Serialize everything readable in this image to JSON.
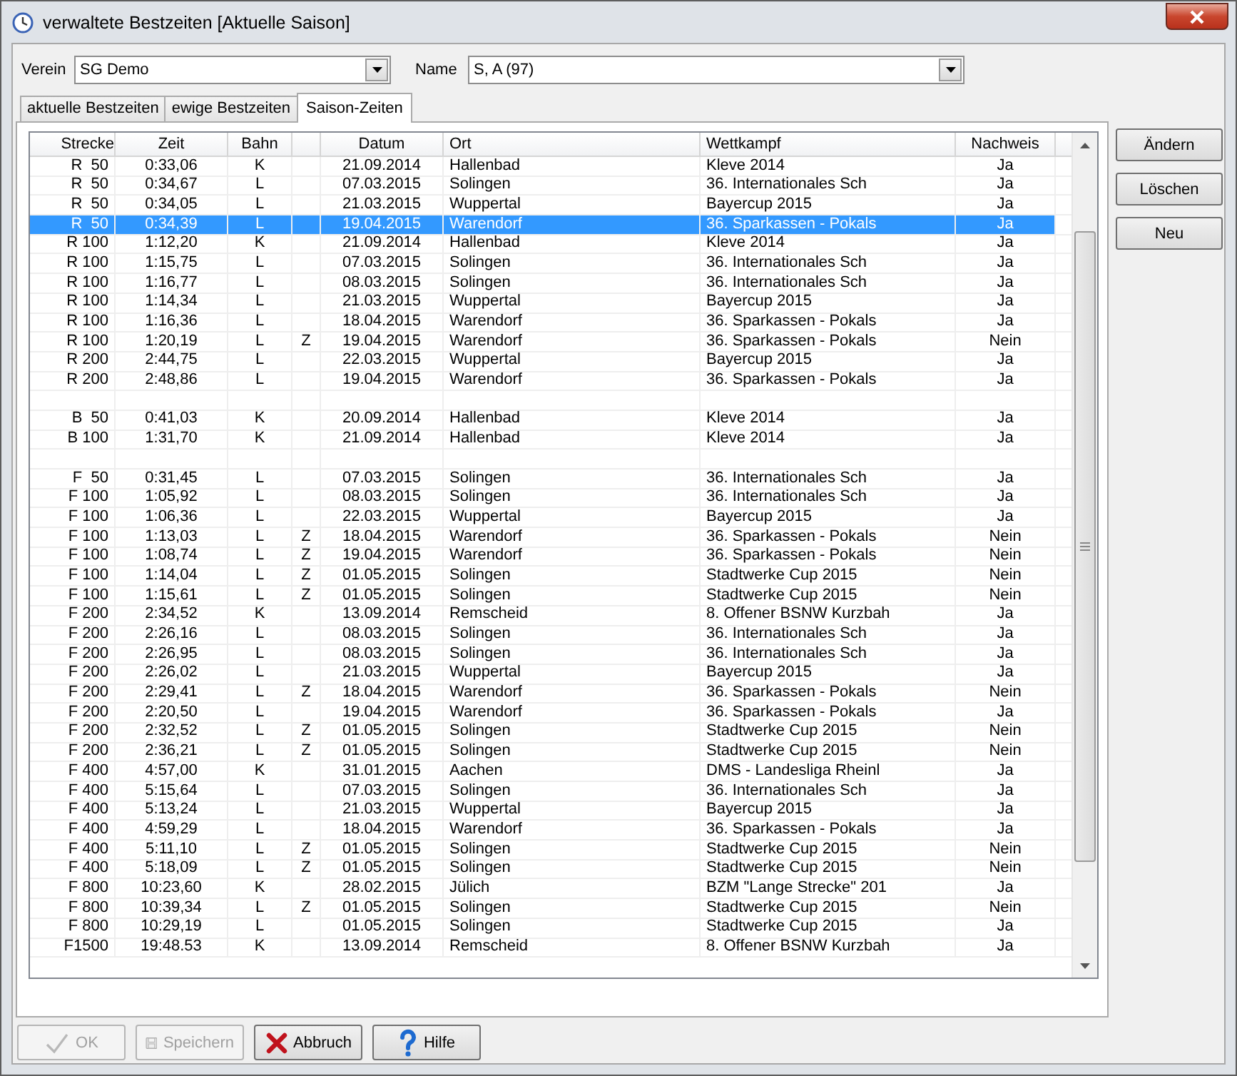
{
  "window": {
    "title": "verwaltete Bestzeiten [Aktuelle Saison]"
  },
  "filters": [
    {
      "label": "Verein",
      "value": "SG Demo"
    },
    {
      "label": "Name",
      "value": "S, A (97)"
    }
  ],
  "tabs": [
    {
      "label": "aktuelle Bestzeiten",
      "selected": false
    },
    {
      "label": "ewige Bestzeiten",
      "selected": false
    },
    {
      "label": "Saison-Zeiten",
      "selected": true
    }
  ],
  "table": {
    "columns": [
      "Strecke",
      "Zeit",
      "Bahn",
      "Datum",
      "Ort",
      "Wettkampf",
      "Nachweis"
    ],
    "rows": [
      {
        "kind": "entry",
        "selected": false,
        "strecke": "R  50",
        "zeit": "0:33,06",
        "bahn": "K",
        "datum": "21.09.2014",
        "ort": "Hallenbad",
        "wettkampf": "Kleve 2014",
        "nachweis": "Ja"
      },
      {
        "kind": "entry",
        "selected": false,
        "strecke": "R  50",
        "zeit": "0:34,67",
        "bahn": "L",
        "datum": "07.03.2015",
        "ort": "Solingen",
        "wettkampf": "36. Internationales Sch",
        "nachweis": "Ja"
      },
      {
        "kind": "entry",
        "selected": false,
        "strecke": "R  50",
        "zeit": "0:34,05",
        "bahn": "L",
        "datum": "21.03.2015",
        "ort": "Wuppertal",
        "wettkampf": "Bayercup 2015",
        "nachweis": "Ja"
      },
      {
        "kind": "entry",
        "selected": true,
        "strecke": "R  50",
        "zeit": "0:34,39",
        "bahn": "L",
        "datum": "19.04.2015",
        "ort": "Warendorf",
        "wettkampf": "36. Sparkassen - Pokals",
        "nachweis": "Ja"
      },
      {
        "kind": "entry",
        "selected": false,
        "strecke": "R 100",
        "zeit": "1:12,20",
        "bahn": "K",
        "datum": "21.09.2014",
        "ort": "Hallenbad",
        "wettkampf": "Kleve 2014",
        "nachweis": "Ja"
      },
      {
        "kind": "entry",
        "selected": false,
        "strecke": "R 100",
        "zeit": "1:15,75",
        "bahn": "L",
        "datum": "07.03.2015",
        "ort": "Solingen",
        "wettkampf": "36. Internationales Sch",
        "nachweis": "Ja"
      },
      {
        "kind": "entry",
        "selected": false,
        "strecke": "R 100",
        "zeit": "1:16,77",
        "bahn": "L",
        "datum": "08.03.2015",
        "ort": "Solingen",
        "wettkampf": "36. Internationales Sch",
        "nachweis": "Ja"
      },
      {
        "kind": "entry",
        "selected": false,
        "strecke": "R 100",
        "zeit": "1:14,34",
        "bahn": "L",
        "datum": "21.03.2015",
        "ort": "Wuppertal",
        "wettkampf": "Bayercup 2015",
        "nachweis": "Ja"
      },
      {
        "kind": "entry",
        "selected": false,
        "strecke": "R 100",
        "zeit": "1:16,36",
        "bahn": "L",
        "datum": "18.04.2015",
        "ort": "Warendorf",
        "wettkampf": "36. Sparkassen - Pokals",
        "nachweis": "Ja"
      },
      {
        "kind": "entry",
        "selected": false,
        "strecke": "R 100",
        "zeit": "1:20,19",
        "bahn": "L",
        "column_4": "Z",
        "datum": "19.04.2015",
        "ort": "Warendorf",
        "wettkampf": "36. Sparkassen - Pokals",
        "nachweis": "Nein"
      },
      {
        "kind": "entry",
        "selected": false,
        "strecke": "R 200",
        "zeit": "2:44,75",
        "bahn": "L",
        "datum": "22.03.2015",
        "ort": "Wuppertal",
        "wettkampf": "Bayercup 2015",
        "nachweis": "Ja"
      },
      {
        "kind": "entry",
        "selected": false,
        "strecke": "R 200",
        "zeit": "2:48,86",
        "bahn": "L",
        "datum": "19.04.2015",
        "ort": "Warendorf",
        "wettkampf": "36. Sparkassen - Pokals",
        "nachweis": "Ja"
      },
      {
        "kind": "blank",
        "selected": false
      },
      {
        "kind": "entry",
        "selected": false,
        "strecke": "B  50",
        "zeit": "0:41,03",
        "bahn": "K",
        "datum": "20.09.2014",
        "ort": "Hallenbad",
        "wettkampf": "Kleve 2014",
        "nachweis": "Ja"
      },
      {
        "kind": "entry",
        "selected": false,
        "strecke": "B 100",
        "zeit": "1:31,70",
        "bahn": "K",
        "datum": "21.09.2014",
        "ort": "Hallenbad",
        "wettkampf": "Kleve 2014",
        "nachweis": "Ja"
      },
      {
        "kind": "blank",
        "selected": false
      },
      {
        "kind": "entry",
        "selected": false,
        "strecke": "F  50",
        "zeit": "0:31,45",
        "bahn": "L",
        "datum": "07.03.2015",
        "ort": "Solingen",
        "wettkampf": "36. Internationales Sch",
        "nachweis": "Ja"
      },
      {
        "kind": "entry",
        "selected": false,
        "strecke": "F 100",
        "zeit": "1:05,92",
        "bahn": "L",
        "datum": "08.03.2015",
        "ort": "Solingen",
        "wettkampf": "36. Internationales Sch",
        "nachweis": "Ja"
      },
      {
        "kind": "entry",
        "selected": false,
        "strecke": "F 100",
        "zeit": "1:06,36",
        "bahn": "L",
        "datum": "22.03.2015",
        "ort": "Wuppertal",
        "wettkampf": "Bayercup 2015",
        "nachweis": "Ja"
      },
      {
        "kind": "entry",
        "selected": false,
        "strecke": "F 100",
        "zeit": "1:13,03",
        "bahn": "L",
        "column_4": "Z",
        "datum": "18.04.2015",
        "ort": "Warendorf",
        "wettkampf": "36. Sparkassen - Pokals",
        "nachweis": "Nein"
      },
      {
        "kind": "entry",
        "selected": false,
        "strecke": "F 100",
        "zeit": "1:08,74",
        "bahn": "L",
        "column_4": "Z",
        "datum": "19.04.2015",
        "ort": "Warendorf",
        "wettkampf": "36. Sparkassen - Pokals",
        "nachweis": "Nein"
      },
      {
        "kind": "entry",
        "selected": false,
        "strecke": "F 100",
        "zeit": "1:14,04",
        "bahn": "L",
        "column_4": "Z",
        "datum": "01.05.2015",
        "ort": "Solingen",
        "wettkampf": "Stadtwerke Cup 2015",
        "nachweis": "Nein"
      },
      {
        "kind": "entry",
        "selected": false,
        "strecke": "F 100",
        "zeit": "1:15,61",
        "bahn": "L",
        "column_4": "Z",
        "datum": "01.05.2015",
        "ort": "Solingen",
        "wettkampf": "Stadtwerke Cup 2015",
        "nachweis": "Nein"
      },
      {
        "kind": "entry",
        "selected": false,
        "strecke": "F 200",
        "zeit": "2:34,52",
        "bahn": "K",
        "datum": "13.09.2014",
        "ort": "Remscheid",
        "wettkampf": "8. Offener BSNW Kurzbah",
        "nachweis": "Ja"
      },
      {
        "kind": "entry",
        "selected": false,
        "strecke": "F 200",
        "zeit": "2:26,16",
        "bahn": "L",
        "datum": "08.03.2015",
        "ort": "Solingen",
        "wettkampf": "36. Internationales Sch",
        "nachweis": "Ja"
      },
      {
        "kind": "entry",
        "selected": false,
        "strecke": "F 200",
        "zeit": "2:26,95",
        "bahn": "L",
        "datum": "08.03.2015",
        "ort": "Solingen",
        "wettkampf": "36. Internationales Sch",
        "nachweis": "Ja"
      },
      {
        "kind": "entry",
        "selected": false,
        "strecke": "F 200",
        "zeit": "2:26,02",
        "bahn": "L",
        "datum": "21.03.2015",
        "ort": "Wuppertal",
        "wettkampf": "Bayercup 2015",
        "nachweis": "Ja"
      },
      {
        "kind": "entry",
        "selected": false,
        "strecke": "F 200",
        "zeit": "2:29,41",
        "bahn": "L",
        "column_4": "Z",
        "datum": "18.04.2015",
        "ort": "Warendorf",
        "wettkampf": "36. Sparkassen - Pokals",
        "nachweis": "Nein"
      },
      {
        "kind": "entry",
        "selected": false,
        "strecke": "F 200",
        "zeit": "2:20,50",
        "bahn": "L",
        "datum": "19.04.2015",
        "ort": "Warendorf",
        "wettkampf": "36. Sparkassen - Pokals",
        "nachweis": "Ja"
      },
      {
        "kind": "entry",
        "selected": false,
        "strecke": "F 200",
        "zeit": "2:32,52",
        "bahn": "L",
        "column_4": "Z",
        "datum": "01.05.2015",
        "ort": "Solingen",
        "wettkampf": "Stadtwerke Cup 2015",
        "nachweis": "Nein"
      },
      {
        "kind": "entry",
        "selected": false,
        "strecke": "F 200",
        "zeit": "2:36,21",
        "bahn": "L",
        "column_4": "Z",
        "datum": "01.05.2015",
        "ort": "Solingen",
        "wettkampf": "Stadtwerke Cup 2015",
        "nachweis": "Nein"
      },
      {
        "kind": "entry",
        "selected": false,
        "strecke": "F 400",
        "zeit": "4:57,00",
        "bahn": "K",
        "datum": "31.01.2015",
        "ort": "Aachen",
        "wettkampf": "DMS - Landesliga Rheinl",
        "nachweis": "Ja"
      },
      {
        "kind": "entry",
        "selected": false,
        "strecke": "F 400",
        "zeit": "5:15,64",
        "bahn": "L",
        "datum": "07.03.2015",
        "ort": "Solingen",
        "wettkampf": "36. Internationales Sch",
        "nachweis": "Ja"
      },
      {
        "kind": "entry",
        "selected": false,
        "strecke": "F 400",
        "zeit": "5:13,24",
        "bahn": "L",
        "datum": "21.03.2015",
        "ort": "Wuppertal",
        "wettkampf": "Bayercup 2015",
        "nachweis": "Ja"
      },
      {
        "kind": "entry",
        "selected": false,
        "strecke": "F 400",
        "zeit": "4:59,29",
        "bahn": "L",
        "datum": "18.04.2015",
        "ort": "Warendorf",
        "wettkampf": "36. Sparkassen - Pokals",
        "nachweis": "Ja"
      },
      {
        "kind": "entry",
        "selected": false,
        "strecke": "F 400",
        "zeit": "5:11,10",
        "bahn": "L",
        "column_4": "Z",
        "datum": "01.05.2015",
        "ort": "Solingen",
        "wettkampf": "Stadtwerke Cup 2015",
        "nachweis": "Nein"
      },
      {
        "kind": "entry",
        "selected": false,
        "strecke": "F 400",
        "zeit": "5:18,09",
        "bahn": "L",
        "column_4": "Z",
        "datum": "01.05.2015",
        "ort": "Solingen",
        "wettkampf": "Stadtwerke Cup 2015",
        "nachweis": "Nein"
      },
      {
        "kind": "entry",
        "selected": false,
        "strecke": "F 800",
        "zeit": "10:23,60",
        "bahn": "K",
        "datum": "28.02.2015",
        "ort": "Jülich",
        "wettkampf": "BZM \"Lange Strecke\" 201",
        "nachweis": "Ja"
      },
      {
        "kind": "entry",
        "selected": false,
        "strecke": "F 800",
        "zeit": "10:39,34",
        "bahn": "L",
        "column_4": "Z",
        "datum": "01.05.2015",
        "ort": "Solingen",
        "wettkampf": "Stadtwerke Cup 2015",
        "nachweis": "Nein"
      },
      {
        "kind": "entry",
        "selected": false,
        "strecke": "F 800",
        "zeit": "10:29,19",
        "bahn": "L",
        "datum": "01.05.2015",
        "ort": "Solingen",
        "wettkampf": "Stadtwerke Cup 2015",
        "nachweis": "Ja"
      },
      {
        "kind": "entry",
        "selected": false,
        "strecke": "F1500",
        "zeit": "19:48.53",
        "bahn": "K",
        "datum": "13.09.2014",
        "ort": "Remscheid",
        "wettkampf": "8. Offener BSNW Kurzbah",
        "nachweis": "Ja"
      }
    ]
  },
  "side_buttons": [
    {
      "label": "Ändern",
      "disabled": false
    },
    {
      "label": "Löschen",
      "disabled": false
    },
    {
      "label": "Neu",
      "disabled": false
    }
  ],
  "bottom_buttons": [
    {
      "kind": "ok",
      "label": "OK",
      "disabled": true
    },
    {
      "kind": "save",
      "label": "Speichern",
      "disabled": true
    },
    {
      "kind": "cancel",
      "label": "Abbruch",
      "disabled": false
    },
    {
      "kind": "help",
      "label": "Hilfe",
      "disabled": false
    }
  ]
}
